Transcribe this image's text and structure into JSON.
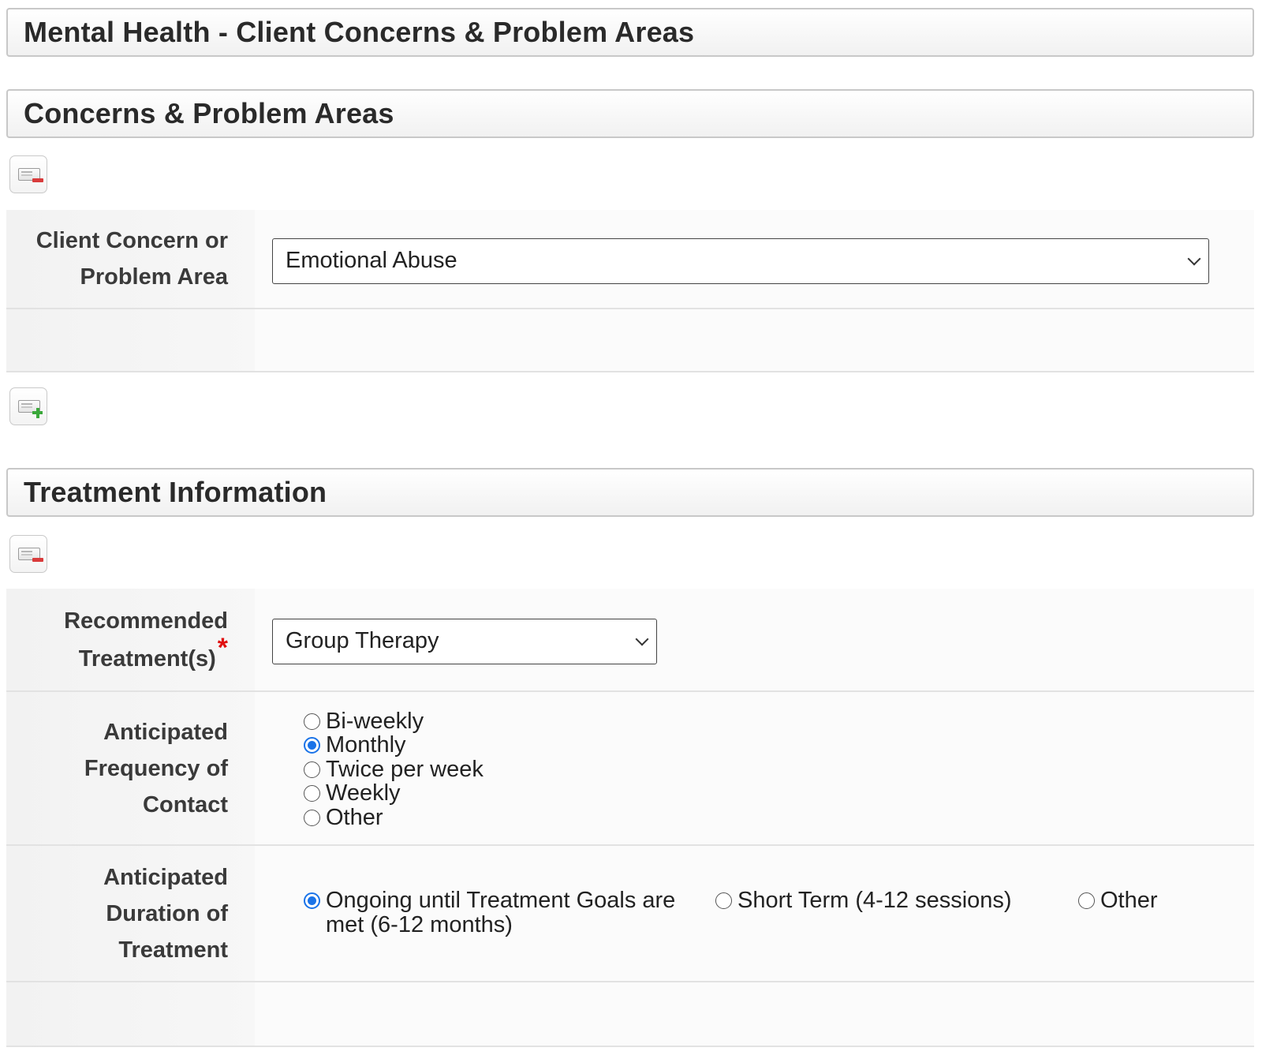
{
  "page_title": "Mental Health - Client Concerns & Problem Areas",
  "concerns_section": {
    "title": "Concerns & Problem Areas",
    "client_concern_label_line1": "Client Concern or",
    "client_concern_label_line2": "Problem Area",
    "client_concern_value": "Emotional Abuse",
    "remove_icon": "remove-record-icon",
    "add_icon": "add-record-icon"
  },
  "treatment_section": {
    "title": "Treatment Information",
    "remove_icon": "remove-record-icon",
    "recommended_label_line1": "Recommended",
    "recommended_label_line2": "Treatment(s)",
    "required_marker": "*",
    "recommended_value": "Group Therapy",
    "frequency_label_line1": "Anticipated",
    "frequency_label_line2": "Frequency of",
    "frequency_label_line3": "Contact",
    "frequency_options": [
      "Bi-weekly",
      "Monthly",
      "Twice per week",
      "Weekly",
      "Other"
    ],
    "frequency_selected": "Monthly",
    "duration_label_line1": "Anticipated",
    "duration_label_line2": "Duration of",
    "duration_label_line3": "Treatment",
    "duration_options": [
      "Ongoing until Treatment Goals are met (6-12 months)",
      "Short Term (4-12 sessions)",
      "Other"
    ],
    "duration_selected": "Ongoing until Treatment Goals are met (6-12 months)"
  },
  "colors": {
    "required": "#e01010",
    "radio_checked": "#1a73e8",
    "remove_accent": "#d93b3b",
    "add_accent": "#3aa83a"
  }
}
